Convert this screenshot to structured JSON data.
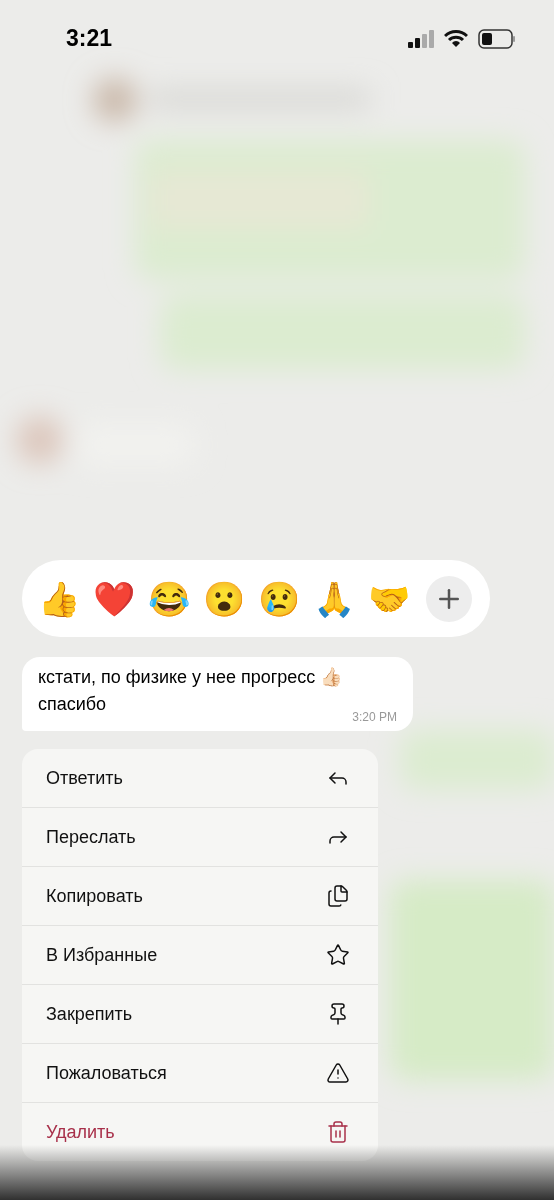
{
  "status_bar": {
    "time": "3:21"
  },
  "reactions": {
    "emojis": [
      "👍",
      "❤️",
      "😂",
      "😮",
      "😢",
      "🙏",
      "🤝"
    ]
  },
  "message": {
    "lines": [
      "кстати, по физике у нее прогресс 👍🏻",
      "спасибо"
    ],
    "time": "3:20 PM"
  },
  "menu": {
    "items": [
      {
        "label": "Ответить",
        "kind": "reply",
        "destructive": false
      },
      {
        "label": "Переслать",
        "kind": "forward",
        "destructive": false
      },
      {
        "label": "Копировать",
        "kind": "copy",
        "destructive": false
      },
      {
        "label": "В Избранные",
        "kind": "favorite",
        "destructive": false
      },
      {
        "label": "Закрепить",
        "kind": "pin",
        "destructive": false
      },
      {
        "label": "Пожаловаться",
        "kind": "report",
        "destructive": false
      },
      {
        "label": "Удалить",
        "kind": "delete",
        "destructive": true
      }
    ]
  }
}
